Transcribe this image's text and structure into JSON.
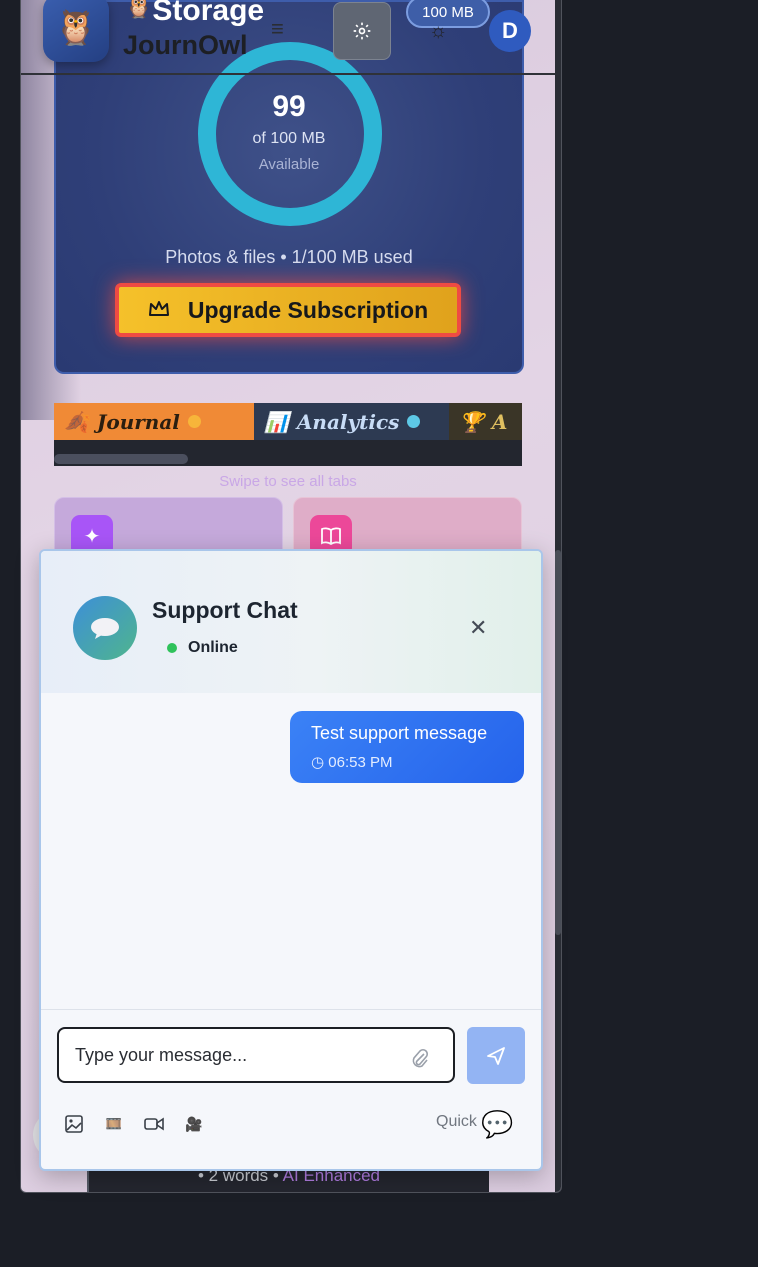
{
  "header": {
    "page_title": "Storage",
    "brand": "JournOwl",
    "storage_pill": "100 MB",
    "avatar_initial": "D",
    "icons": [
      "owl-logo",
      "menu-icon",
      "gear-icon",
      "sun-icon"
    ]
  },
  "storage": {
    "available_value": "99",
    "of_total": "of 100 MB",
    "available_label": "Available",
    "usage_text": "Photos & files • 1/100 MB used",
    "upgrade_label": "Upgrade Subscription",
    "used_fraction": 0.01
  },
  "tabs": {
    "items": [
      {
        "label": "Journal",
        "icon": "🍂",
        "dot_color": "#f7b53a"
      },
      {
        "label": "Analytics",
        "icon": "📊",
        "dot_color": "#5dc8e6"
      },
      {
        "label": "A",
        "icon": "🏆"
      }
    ],
    "swipe_hint": "Swipe to see all tabs"
  },
  "entry": {
    "words": "2 words",
    "ai_label": "AI Enhanced"
  },
  "chat": {
    "title": "Support Chat",
    "status": "Online",
    "messages": [
      {
        "text": "Test support message",
        "time": "06:53 PM"
      }
    ],
    "input_placeholder": "Type your message...",
    "quick_reply": "Quick r  !"
  },
  "colors": {
    "accent": "#2563eb",
    "upgrade": "#f5c12a",
    "ring": "#2eb6d6",
    "online": "#2fc25b"
  }
}
